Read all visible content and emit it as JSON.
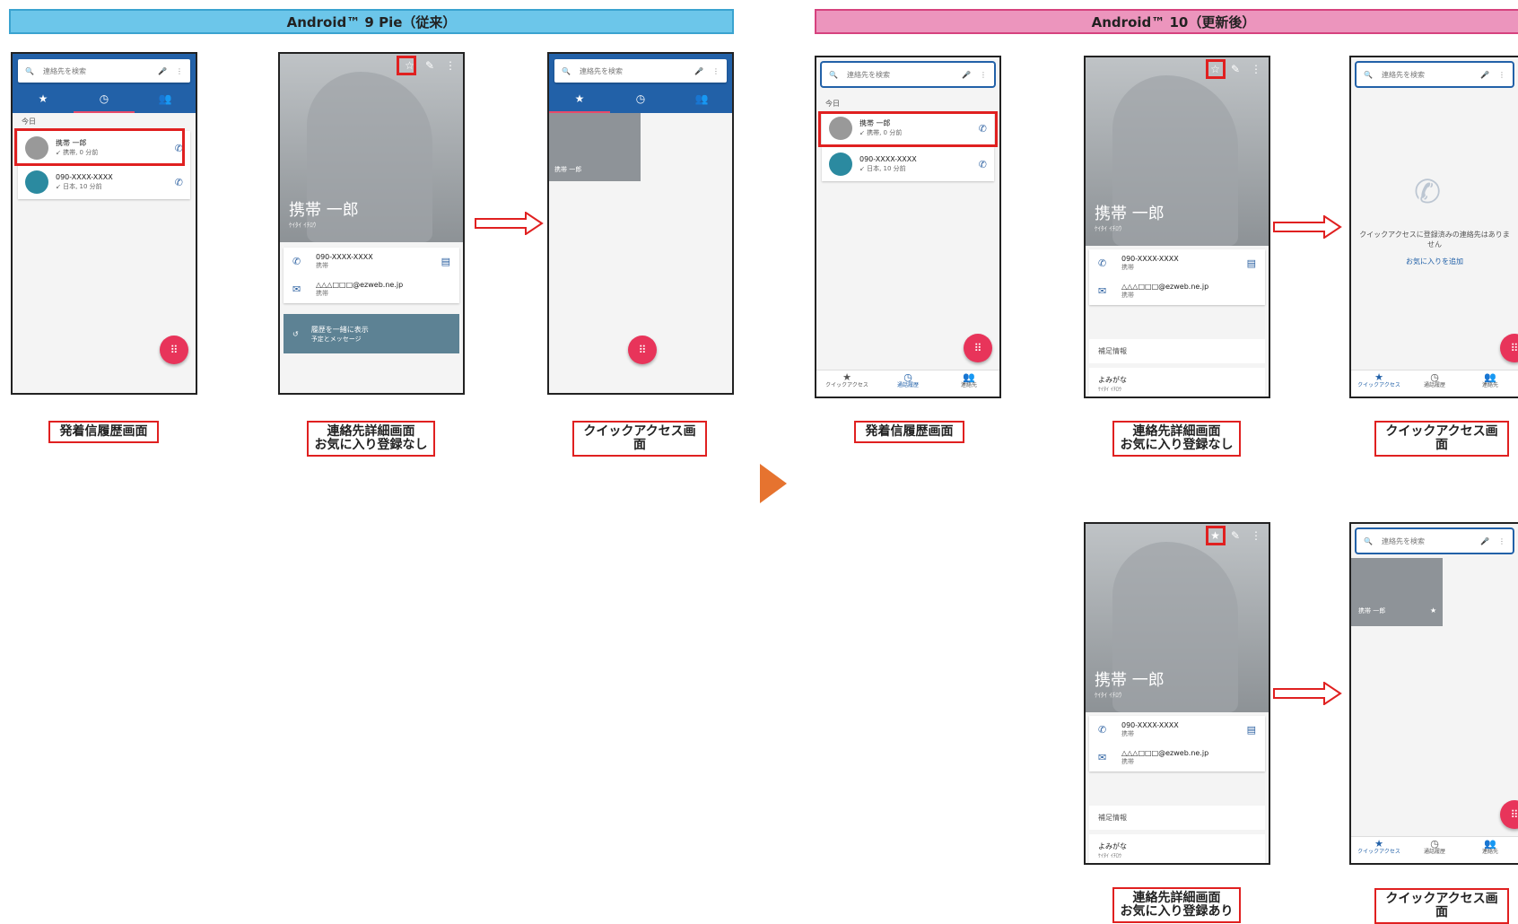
{
  "headers": {
    "left": "Android™ 9 Pie（従来）",
    "right": "Android™ 10（更新後）"
  },
  "search": {
    "placeholder": "連絡先を検索"
  },
  "history": {
    "day": "今日",
    "rows": [
      {
        "name": "携帯 一郎",
        "sub": "↙ 携帯, 0 分前"
      },
      {
        "name": "090-XXXX-XXXX",
        "sub": "↙ 日本, 10 分前"
      }
    ]
  },
  "contact": {
    "name": "携帯 一郎",
    "kana": "ｹｲﾀｲ ｲﾁﾛｳ",
    "phone": "090-XXXX-XXXX",
    "phone_type": "携帯",
    "email": "△△△□□□@ezweb.ne.jp",
    "email_type": "携帯",
    "history_title": "履歴を一緒に表示",
    "history_sub": "予定とメッセージ",
    "supplement": "補足情報",
    "yomigana": "よみがな",
    "yomigana_value": "ｹｲﾀｲ ｲﾁﾛｳ"
  },
  "quick": {
    "thumb_name": "携帯 一郎",
    "empty": "クイックアクセスに登録済みの連絡先はありません",
    "add_favorite": "お気に入りを追加"
  },
  "bottom_nav": {
    "quick": "クイックアクセス",
    "history": "通話履歴",
    "contacts": "連絡先"
  },
  "captions": {
    "history": "発着信履歴画面",
    "detail_no_fav": "連絡先詳細画面\nお気に入り登録なし",
    "detail_fav": "連絡先詳細画面\nお気に入り登録あり",
    "quick": "クイックアクセス画面"
  },
  "icons": {
    "search": "search-icon",
    "mic": "mic-icon",
    "more": "more-icon",
    "star": "star-icon",
    "clock": "clock-icon",
    "people": "people-icon",
    "phone": "phone-icon",
    "mail": "mail-icon",
    "message": "message-icon",
    "edit": "edit-icon",
    "dialpad": "dialpad-icon"
  },
  "colors": {
    "blue": "#2261a8",
    "fab": "#e8345a",
    "highlight": "#e02020",
    "header_left": "#6cc6ea",
    "header_right": "#ec95bd"
  }
}
